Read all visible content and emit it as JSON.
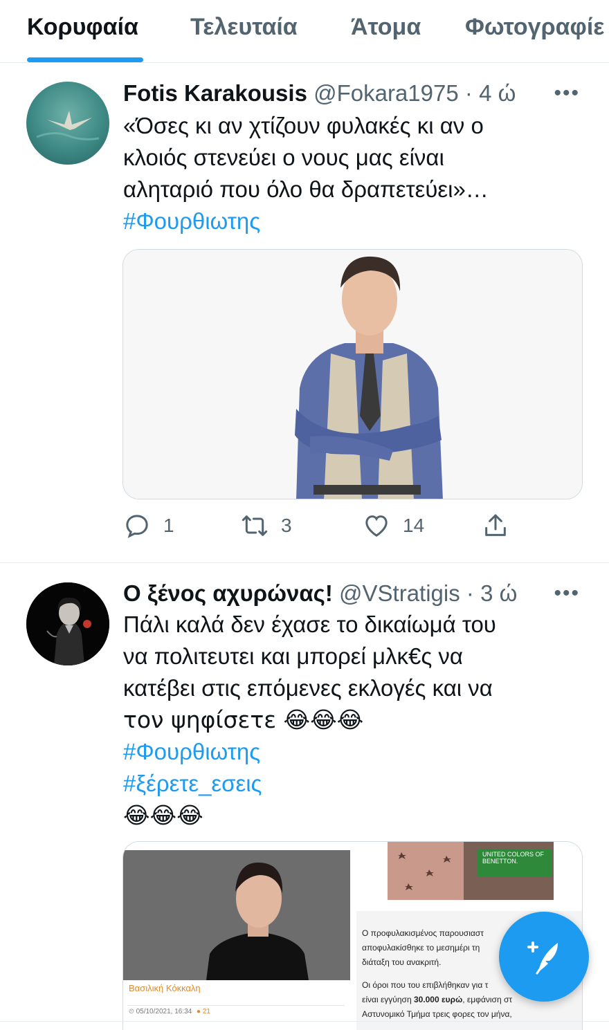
{
  "tabs": [
    {
      "label": "Κορυφαία",
      "active": true
    },
    {
      "label": "Τελευταία",
      "active": false
    },
    {
      "label": "Άτομα",
      "active": false
    },
    {
      "label": "Φωτογραφίε",
      "active": false
    }
  ],
  "tweets": [
    {
      "name": "Fotis Karakousis",
      "handle": "@Fokara1975",
      "separator": "·",
      "time": "4 ώ",
      "more": "•••",
      "lines": [
        "«Όσες κι αν χτίζουν φυλακές κι αν ο",
        "κλοιός στενεύει ο νους μας είναι",
        "αλητα­ριό που όλο θα δραπετεύει»…"
      ],
      "hashtags": [
        "#Φουρθιωτης"
      ],
      "reply_count": "1",
      "retweet_count": "3",
      "like_count": "14"
    },
    {
      "name": "Ο ξένος αχυρώνας!",
      "handle": "@VStratigis",
      "separator": "·",
      "time": "3 ώ",
      "more": "•••",
      "lines": [
        "Πάλι καλά δεν έχασε το δικαίωμά του",
        "να πολιτευτει και μπορεί μλκ€ς να",
        "κατέβει στις επόμενες εκλογές και να",
        "τον ψηφίσετε 😂😂😂"
      ],
      "hashtags": [
        "#Φουρθιωτης",
        "#ξέρετε_εσεις"
      ],
      "trailing": "😂😂😂",
      "article": {
        "author": "Βασιλική Κόκκαλη",
        "date": "05/10/2021, 16:34",
        "comments": "21",
        "brand": "UNITED COLORS OF BENETTON.",
        "p1": "Ο προφυλακισμένος παρουσιαστ",
        "p1b": "αποφυλακίσθηκε το μεσημέρι τη",
        "p1c": "διάταξη του ανακριτή.",
        "p2": "Οι όροι που του επιβλήθηκαν για τ",
        "p2b_pre": "είναι εγγύηση ",
        "p2b_bold": "30.000 ευρώ",
        "p2b_post": ", εμφάνιση στ",
        "p2c": "Αστυνομικό Τμήμα τρεις φορες τον μήνα,"
      }
    }
  ],
  "colors": {
    "accent": "#1d9bf0",
    "secondary_text": "#536471",
    "border": "#cfd9de"
  },
  "fab_icon": "compose-tweet-icon"
}
